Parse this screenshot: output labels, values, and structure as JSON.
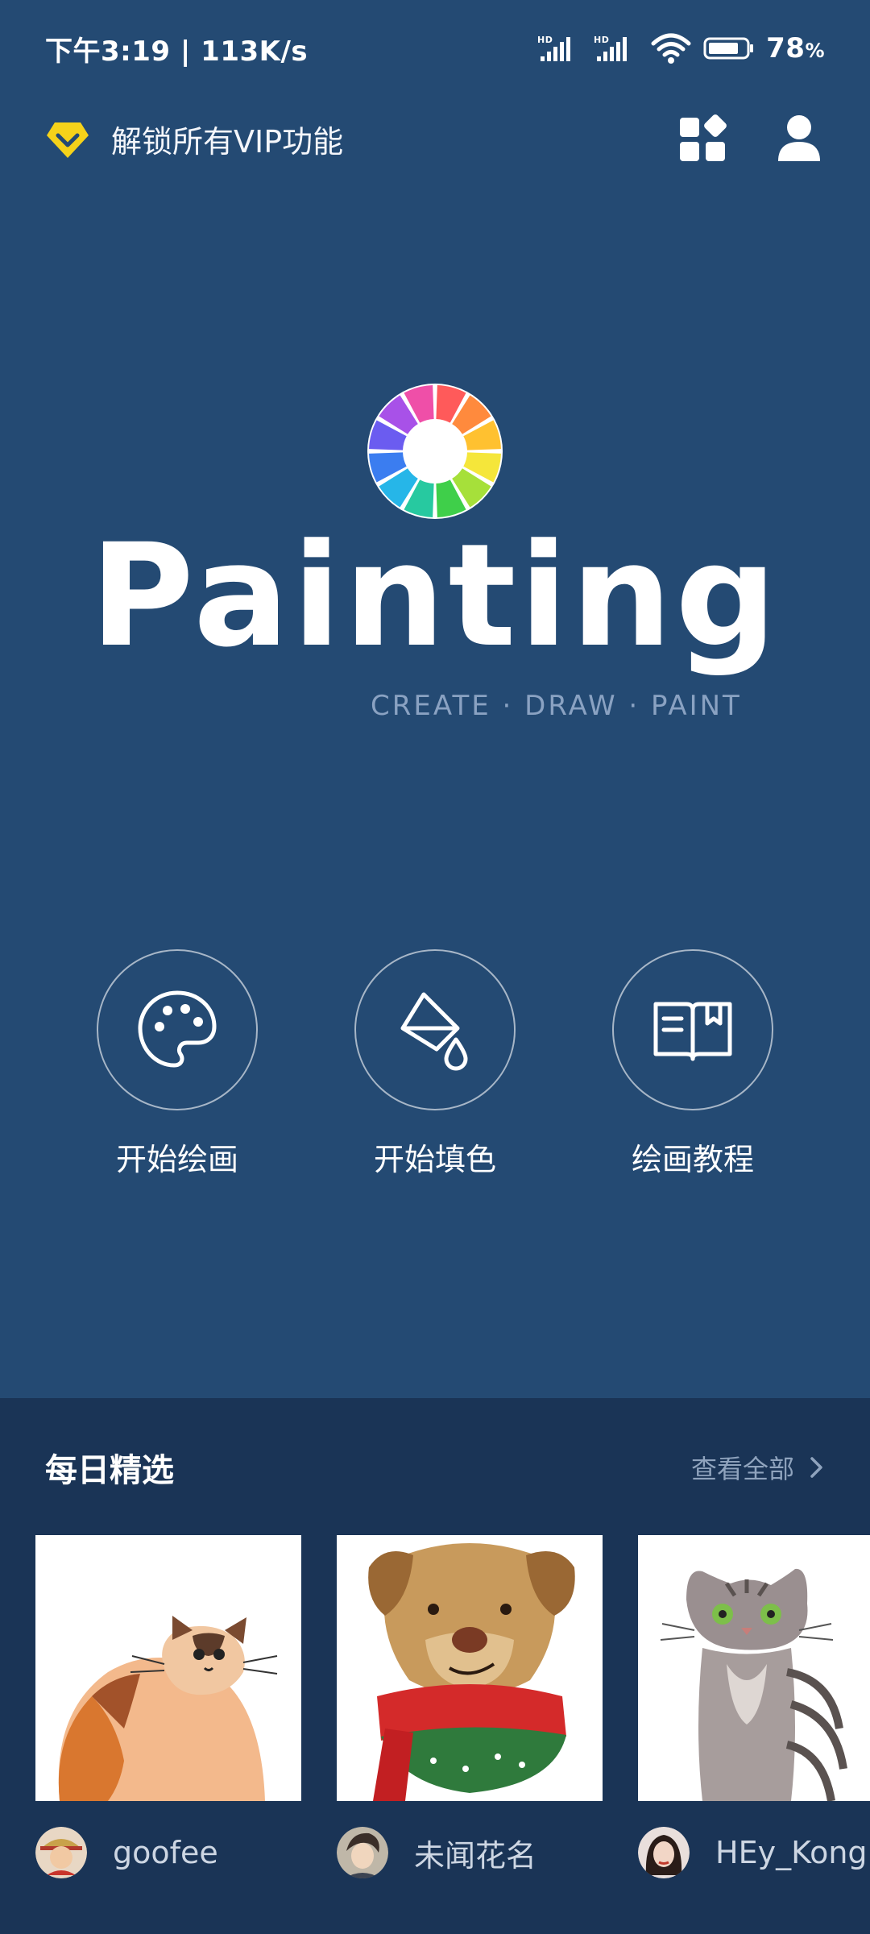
{
  "status_bar": {
    "time_speed": "下午3:19 | 113K/s",
    "battery_percent": "78",
    "battery_unit": "%",
    "signal_labels": [
      "HD",
      "HD"
    ]
  },
  "topbar": {
    "vip_text": "解锁所有VIP功能"
  },
  "logo": {
    "app_name": "Painting",
    "tagline": "CREATE · DRAW · PAINT"
  },
  "actions": [
    {
      "label": "开始绘画",
      "icon": "palette-icon"
    },
    {
      "label": "开始填色",
      "icon": "paint-bucket-icon"
    },
    {
      "label": "绘画教程",
      "icon": "book-icon"
    }
  ],
  "daily": {
    "title": "每日精选",
    "view_all": "查看全部",
    "items": [
      {
        "author": "goofee",
        "subject": "cat"
      },
      {
        "author": "未闻花名",
        "subject": "dog"
      },
      {
        "author": "HEy_Kong",
        "subject": "tabby cat"
      }
    ]
  },
  "colors": {
    "background": "#244a73",
    "daily_background": "#1a3456",
    "vip_accent": "#f5d21a"
  }
}
